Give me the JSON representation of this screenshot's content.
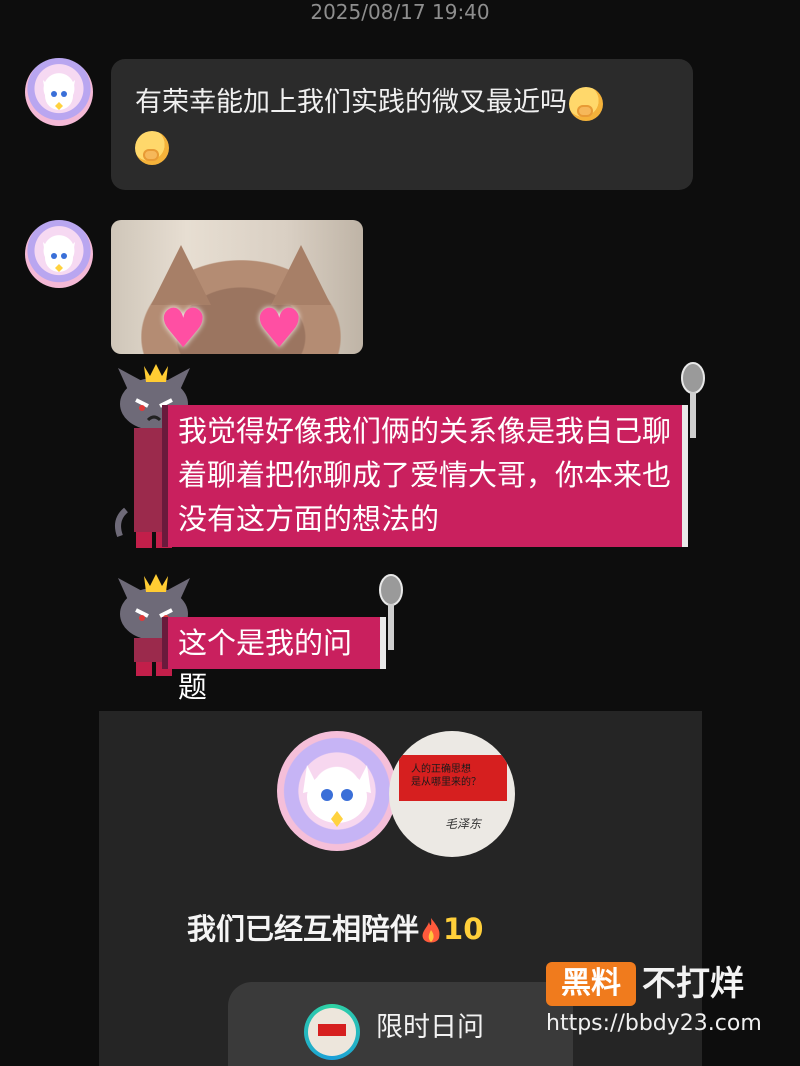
{
  "timestamp": "2025/08/17 19:40",
  "messages": [
    {
      "type": "text",
      "text": "有荣幸能加上我们实践的微叉最近吗"
    },
    {
      "type": "image",
      "hearts": [
        "♥",
        "♥"
      ]
    },
    {
      "type": "sticker",
      "lines": [
        "我觉得好像我们俩的关系像是我自己聊",
        "着聊着把你聊成了爱情大哥，你本来也",
        "没有这方面的想法的"
      ]
    },
    {
      "type": "sticker",
      "lines": [
        "这个是我的问题"
      ]
    }
  ],
  "card": {
    "partner_label": [
      "人的正确思想",
      "是从哪里来的？"
    ],
    "partner_signature": "毛泽东",
    "together_text": "我们已经互相陪伴",
    "together_count": "10",
    "pill_label": "限时日问"
  },
  "watermark": {
    "box": "黑料",
    "text": "不打烊",
    "url": "https://bbdy23.com"
  },
  "colors": {
    "background": "#0d0d0d",
    "bubble": "#2b2b2b",
    "sticker": "#c9205e",
    "card": "#252525",
    "watermark": "#f07b1d"
  }
}
